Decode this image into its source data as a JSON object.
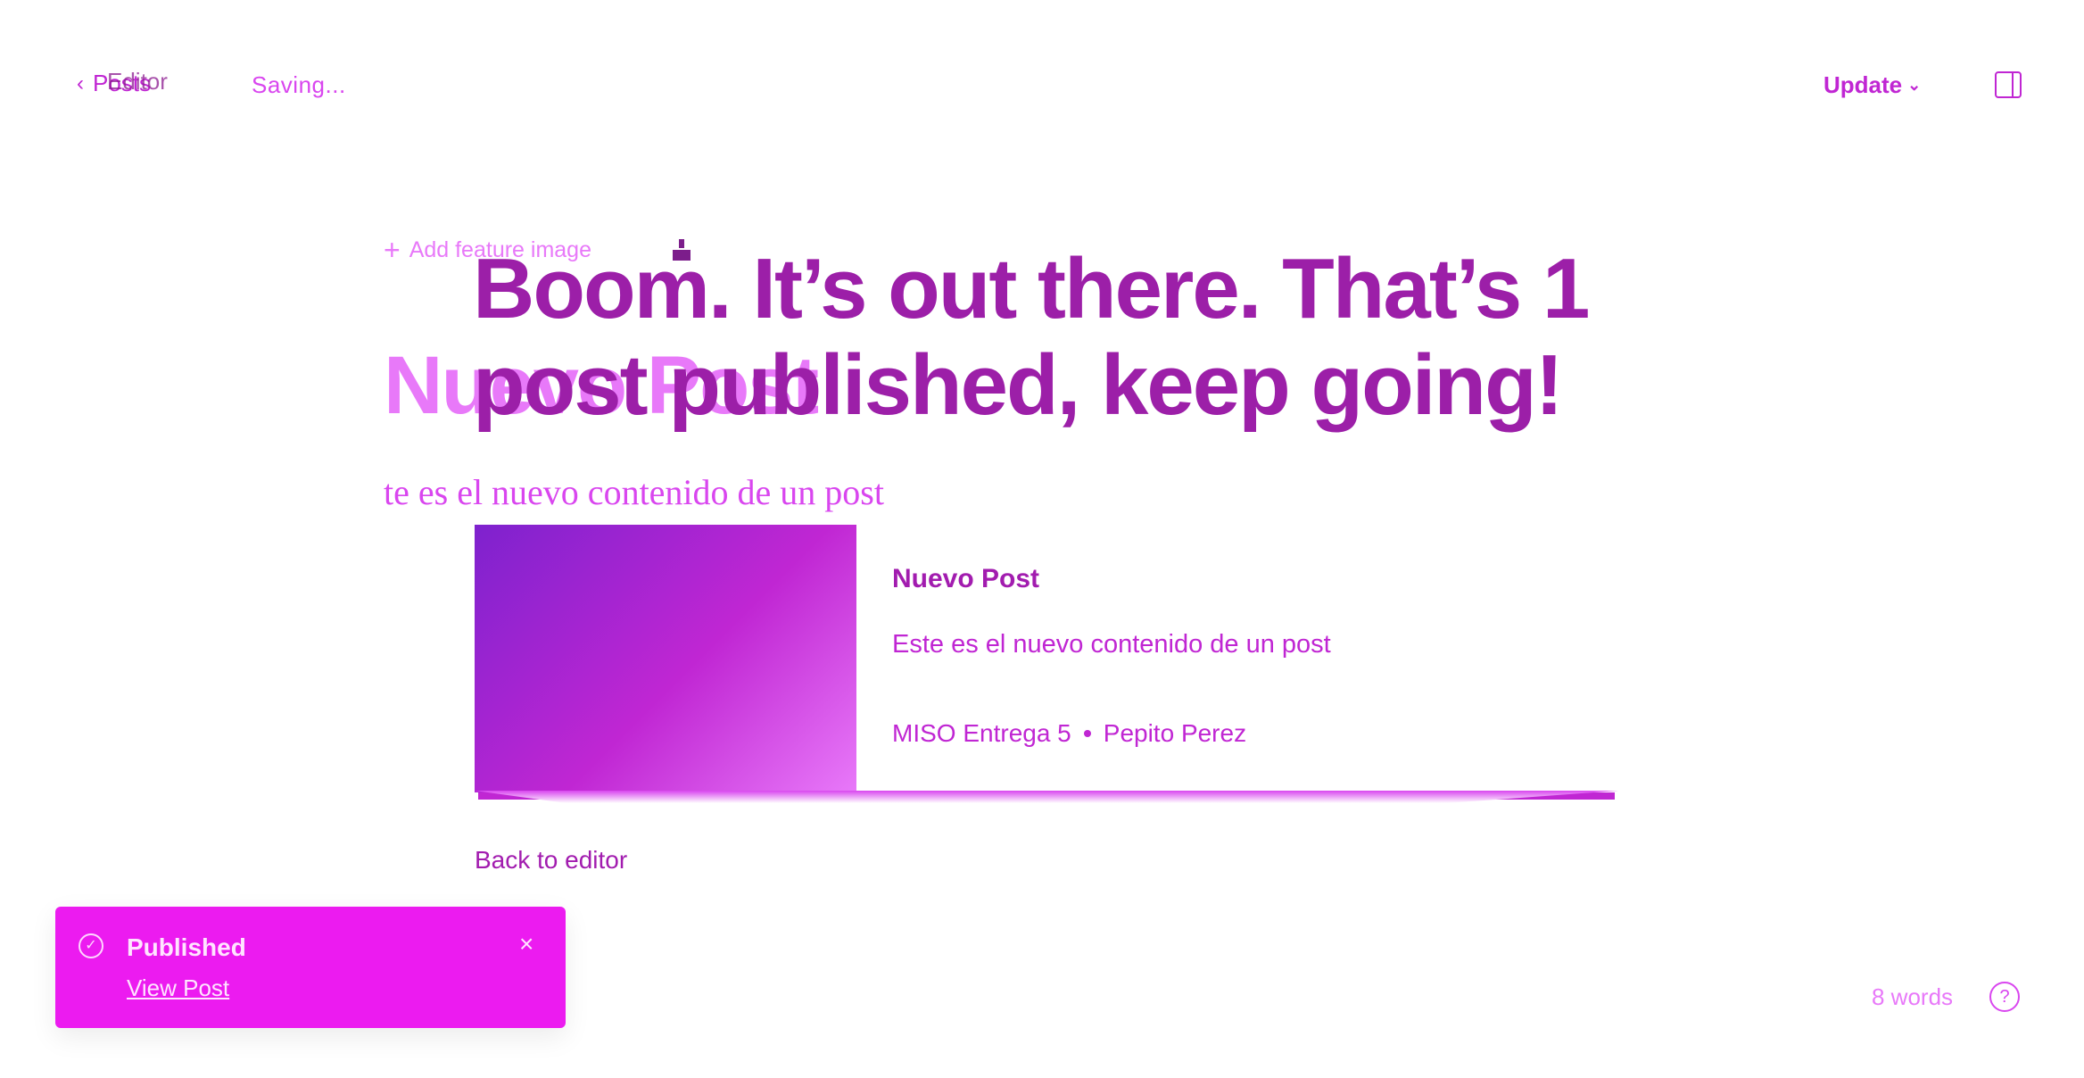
{
  "topbar": {
    "back_label": "Posts",
    "editor_label": "Editor",
    "status": "Saving...",
    "update_label": "Update",
    "sidebar_icon": "sidebar-toggle-icon"
  },
  "editor": {
    "feature_image_label": "Add feature image",
    "title": "Nuevo Post",
    "body": "te es el nuevo contenido de un post"
  },
  "publish_modal": {
    "headline_line1": "Boom. It’s out there. That’s 1",
    "headline_line2": "post published, keep going!",
    "card": {
      "title": "Nuevo Post",
      "excerpt": "Este es el nuevo contenido de un post",
      "site": "MISO Entrega 5",
      "author": "Pepito Perez"
    },
    "back_to_editor": "Back to editor"
  },
  "toast": {
    "title": "Published",
    "link": "View Post",
    "close": "×"
  },
  "footer": {
    "word_count": "8 words",
    "help": "?"
  }
}
